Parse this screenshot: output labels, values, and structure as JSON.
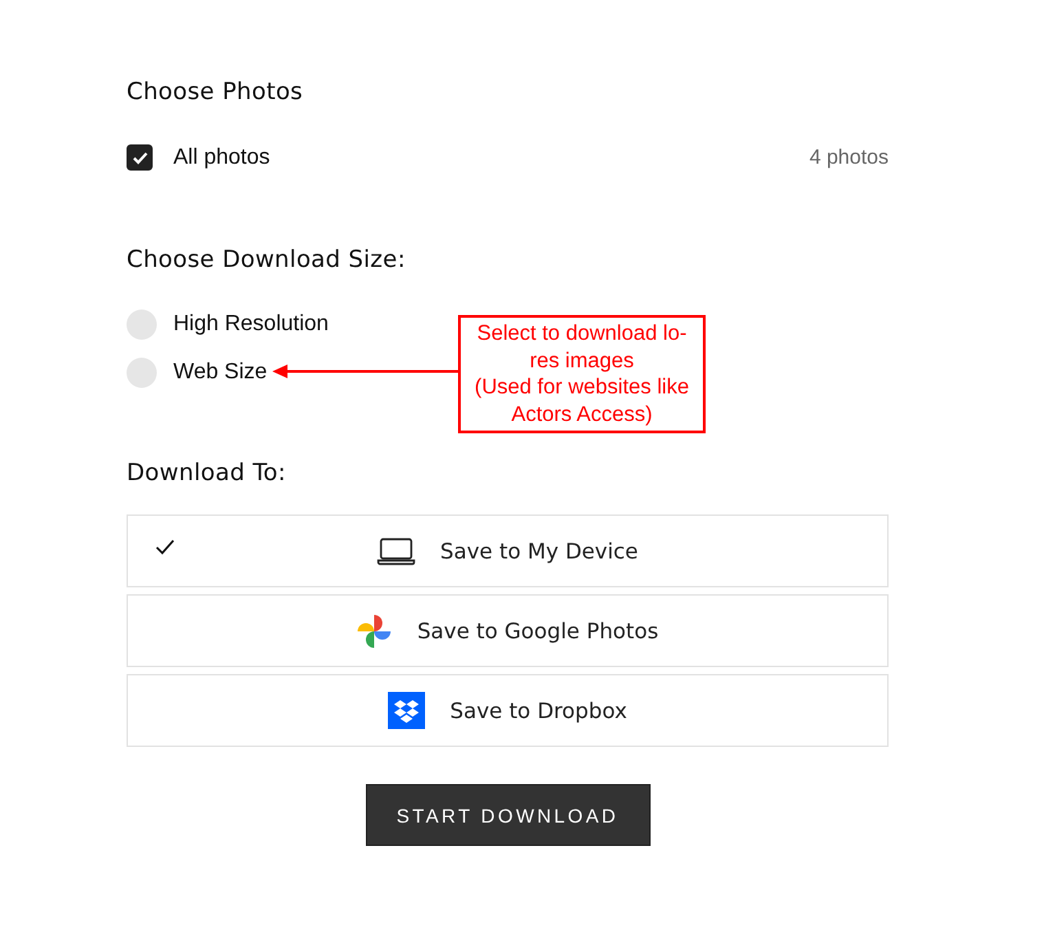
{
  "photos": {
    "heading": "Choose Photos",
    "option": {
      "label": "All photos",
      "checked": true,
      "count": "4 photos"
    }
  },
  "size": {
    "heading": "Choose Download Size:",
    "options": [
      {
        "label": "High Resolution",
        "selected": false
      },
      {
        "label": "Web Size",
        "selected": false
      }
    ]
  },
  "annotation": {
    "lines": [
      "Select to download lo-",
      "res images",
      "(Used for websites like",
      "Actors Access)"
    ]
  },
  "destination": {
    "heading": "Download To:",
    "options": [
      {
        "label": "Save to My Device",
        "kind": "laptop",
        "selected": true
      },
      {
        "label": "Save to Google Photos",
        "kind": "pinwheel",
        "selected": false
      },
      {
        "label": "Save to Dropbox",
        "kind": "dropbox",
        "selected": false
      }
    ]
  },
  "button": "START DOWNLOAD"
}
